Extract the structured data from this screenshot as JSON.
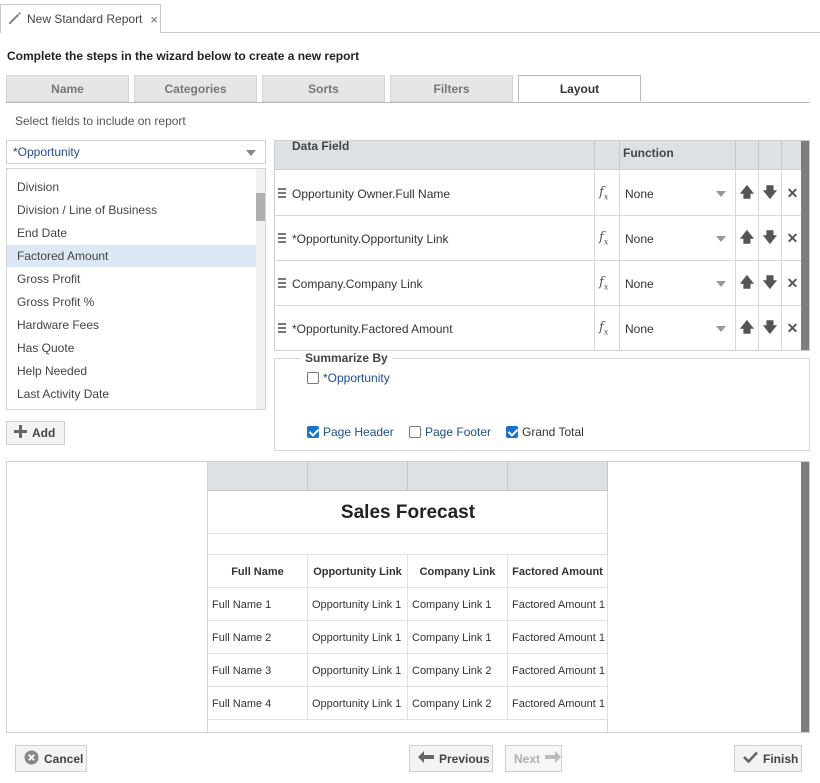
{
  "doc_tab": {
    "title": "New Standard Report",
    "close": "×"
  },
  "instructions": "Complete the steps in the wizard below to create a new report",
  "wizard_tabs": [
    {
      "label": "Name",
      "active": false
    },
    {
      "label": "Categories",
      "active": false
    },
    {
      "label": "Sorts",
      "active": false
    },
    {
      "label": "Filters",
      "active": false
    },
    {
      "label": "Layout",
      "active": true
    }
  ],
  "fields_panel": {
    "label": "Select fields to include on report",
    "object_select": "*Opportunity",
    "items": [
      "Division",
      "Division / Line of Business",
      "End Date",
      "Factored Amount",
      "Gross Profit",
      "Gross Profit %",
      "Hardware Fees",
      "Has Quote",
      "Help Needed",
      "Last Activity Date"
    ],
    "selected_index": 3,
    "add_label": "Add"
  },
  "grid": {
    "headers": {
      "data_field": "Data Field",
      "function": "Function"
    },
    "rows": [
      {
        "field": "Opportunity Owner.Full Name",
        "function": "None"
      },
      {
        "field": "*Opportunity.Opportunity Link",
        "function": "None"
      },
      {
        "field": "Company.Company Link",
        "function": "None"
      },
      {
        "field": "*Opportunity.Factored Amount",
        "function": "None"
      }
    ]
  },
  "summarize": {
    "legend": "Summarize By",
    "options": [
      {
        "label": "*Opportunity",
        "checked": false
      }
    ],
    "page_header": {
      "label": "Page Header",
      "checked": true
    },
    "page_footer": {
      "label": "Page Footer",
      "checked": false
    },
    "grand_total": {
      "label": "Grand Total",
      "checked": true
    }
  },
  "preview": {
    "title": "Sales Forecast",
    "columns": [
      "Full Name",
      "Opportunity Link",
      "Company Link",
      "Factored Amount"
    ],
    "rows": [
      [
        "Full Name 1",
        "Opportunity Link 1",
        "Company Link 1",
        "Factored Amount 1"
      ],
      [
        "Full Name 2",
        "Opportunity Link 1",
        "Company Link 1",
        "Factored Amount 1"
      ],
      [
        "Full Name 3",
        "Opportunity Link 1",
        "Company Link 2",
        "Factored Amount 1"
      ],
      [
        "Full Name 4",
        "Opportunity Link 1",
        "Company Link 2",
        "Factored Amount 1"
      ]
    ]
  },
  "footer": {
    "cancel": "Cancel",
    "previous": "Previous",
    "next": "Next",
    "finish": "Finish"
  },
  "colors": {
    "accent": "#1a73c9",
    "link": "#1f4e8a",
    "selected": "#dde8f7",
    "header": "#dde1e4"
  },
  "icons": [
    "pencil-icon",
    "close-icon",
    "caret-down-icon",
    "plus-icon",
    "drag-handle-icon",
    "function-icon",
    "arrow-up-icon",
    "arrow-down-icon",
    "remove-icon",
    "cancel-icon",
    "arrow-left-icon",
    "arrow-right-icon",
    "check-icon"
  ]
}
